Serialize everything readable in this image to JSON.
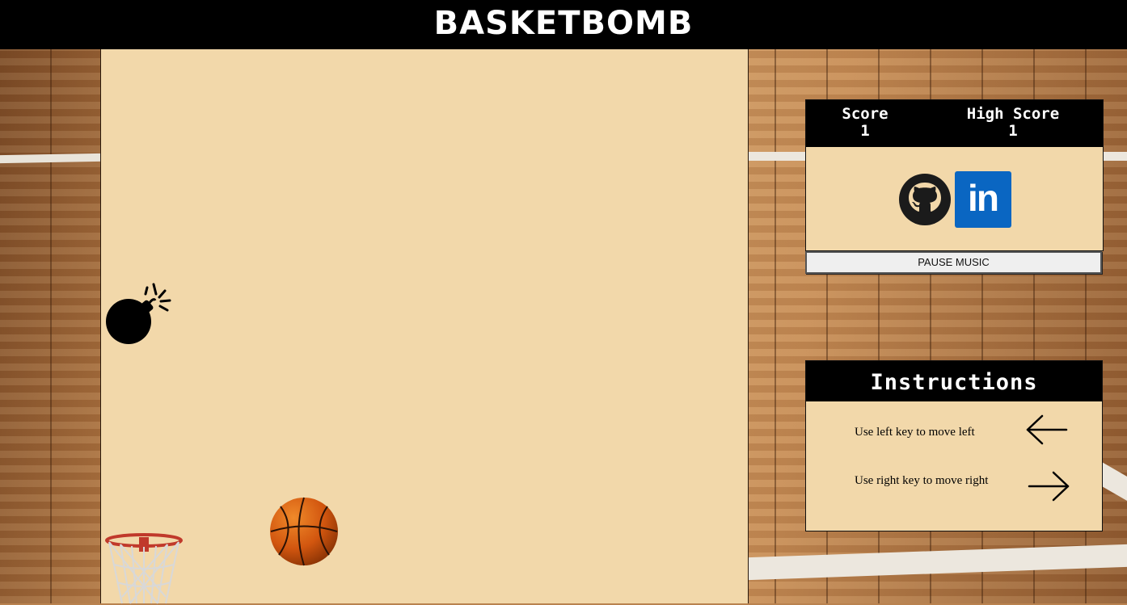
{
  "header": {
    "title": "BASKETBOMB"
  },
  "score": {
    "score_label": "Score",
    "score_value": "1",
    "high_score_label": "High Score",
    "high_score_value": "1"
  },
  "links": [
    {
      "icon": "github-icon"
    },
    {
      "icon": "linkedin-icon",
      "text": "in"
    }
  ],
  "music": {
    "button_label": "PAUSE MUSIC"
  },
  "instructions": {
    "title": "Instructions",
    "items": [
      {
        "text": "Use left key to move left",
        "icon": "left-arrow-icon"
      },
      {
        "text": "Use right key to move right",
        "icon": "right-arrow-icon"
      }
    ]
  },
  "game": {
    "sprites": [
      "bomb-icon",
      "basketball-icon",
      "hoop-icon"
    ]
  },
  "colors": {
    "header_bg": "#000000",
    "game_bg": "#f2d8aa",
    "linkedin_blue": "#0a66c2"
  }
}
